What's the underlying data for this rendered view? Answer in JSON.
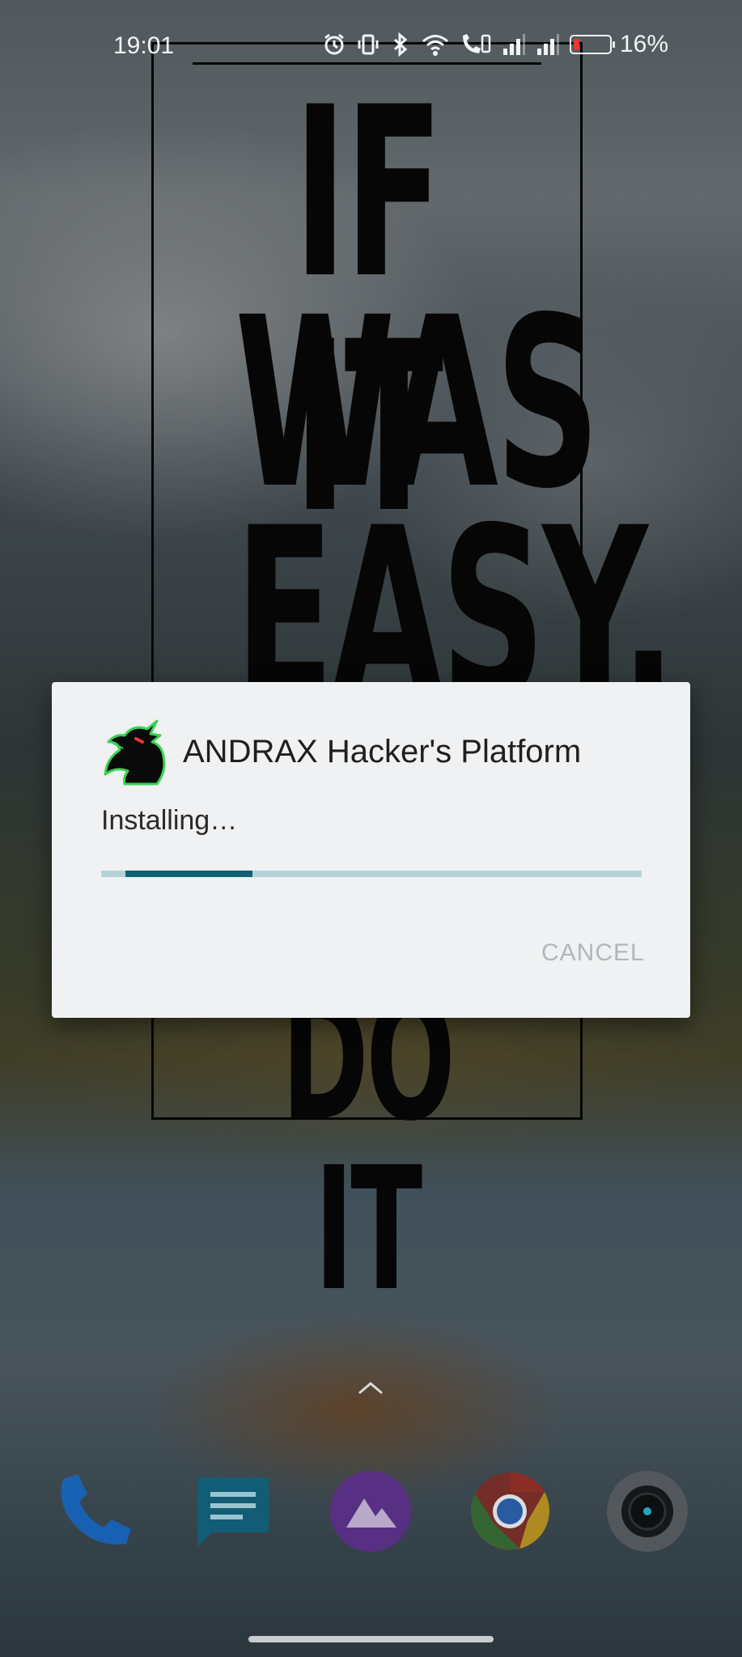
{
  "status_bar": {
    "time": "19:01",
    "icons": [
      "alarm-icon",
      "vibrate-icon",
      "bluetooth-icon",
      "wifi-icon",
      "wifi-calling-icon",
      "signal-icon",
      "signal-icon"
    ],
    "battery_percent": "16%",
    "battery_level": 0.16,
    "battery_color": "#e53935"
  },
  "wallpaper": {
    "poster_lines": [
      "IF IT",
      "WAS",
      "EASY,",
      "DO IT"
    ]
  },
  "dialog": {
    "app_name": "ANDRAX Hacker's Platform",
    "app_icon": "andrax-dragon-icon",
    "status": "Installing…",
    "progress": {
      "indeterminate": true,
      "segment_start": 0.045,
      "segment_end": 0.28
    },
    "cancel_label": "CANCEL",
    "colors": {
      "progress_track": "#b6d2d8",
      "progress_fill": "#0e6271",
      "cancel": "#b3b6b8"
    }
  },
  "dock": {
    "apps": [
      {
        "name": "Phone",
        "icon": "phone-icon"
      },
      {
        "name": "Messages",
        "icon": "messages-icon"
      },
      {
        "name": "Gallery",
        "icon": "gallery-icon"
      },
      {
        "name": "Chrome",
        "icon": "chrome-icon"
      },
      {
        "name": "Camera",
        "icon": "camera-icon"
      }
    ]
  }
}
